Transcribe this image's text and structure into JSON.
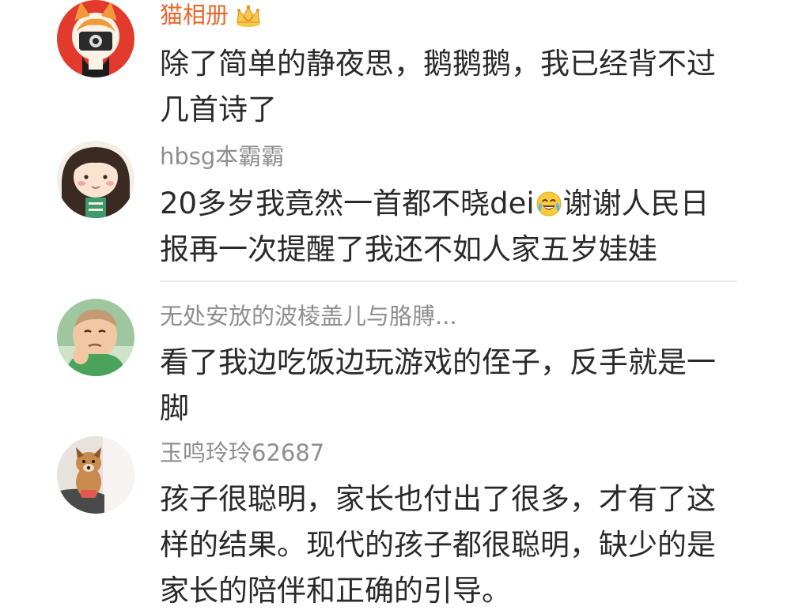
{
  "comments": [
    {
      "user": "猫相册",
      "vip_badge": "crown-icon",
      "lines": [
        "除了简单的静夜思，鹅鹅鹅，我已经背不过",
        "几首诗了"
      ]
    },
    {
      "user": "hbsg本霸霸",
      "lines_pre": "20多岁我竟然一首都不晓dei",
      "emoji": "laughing-crying-emoji",
      "lines_post": "谢谢人民日",
      "line2": "报再一次提醒了我还不如人家五岁娃娃"
    },
    {
      "user": "无处安放的波棱盖儿与胳膊...",
      "lines": [
        "看了我边吃饭边玩游戏的侄子，反手就是一",
        "脚"
      ]
    },
    {
      "user": "玉鸣玲玲62687",
      "lines": [
        "孩子很聪明，家长也付出了很多，才有了这",
        "样的结果。现代的孩子都很聪明，缺少的是",
        "家长的陪伴和正确的引导。"
      ]
    }
  ],
  "colors": {
    "vip_name": "#e9672a",
    "name": "#8e8e8e",
    "text": "#2a2a2a",
    "divider": "#ececec"
  }
}
